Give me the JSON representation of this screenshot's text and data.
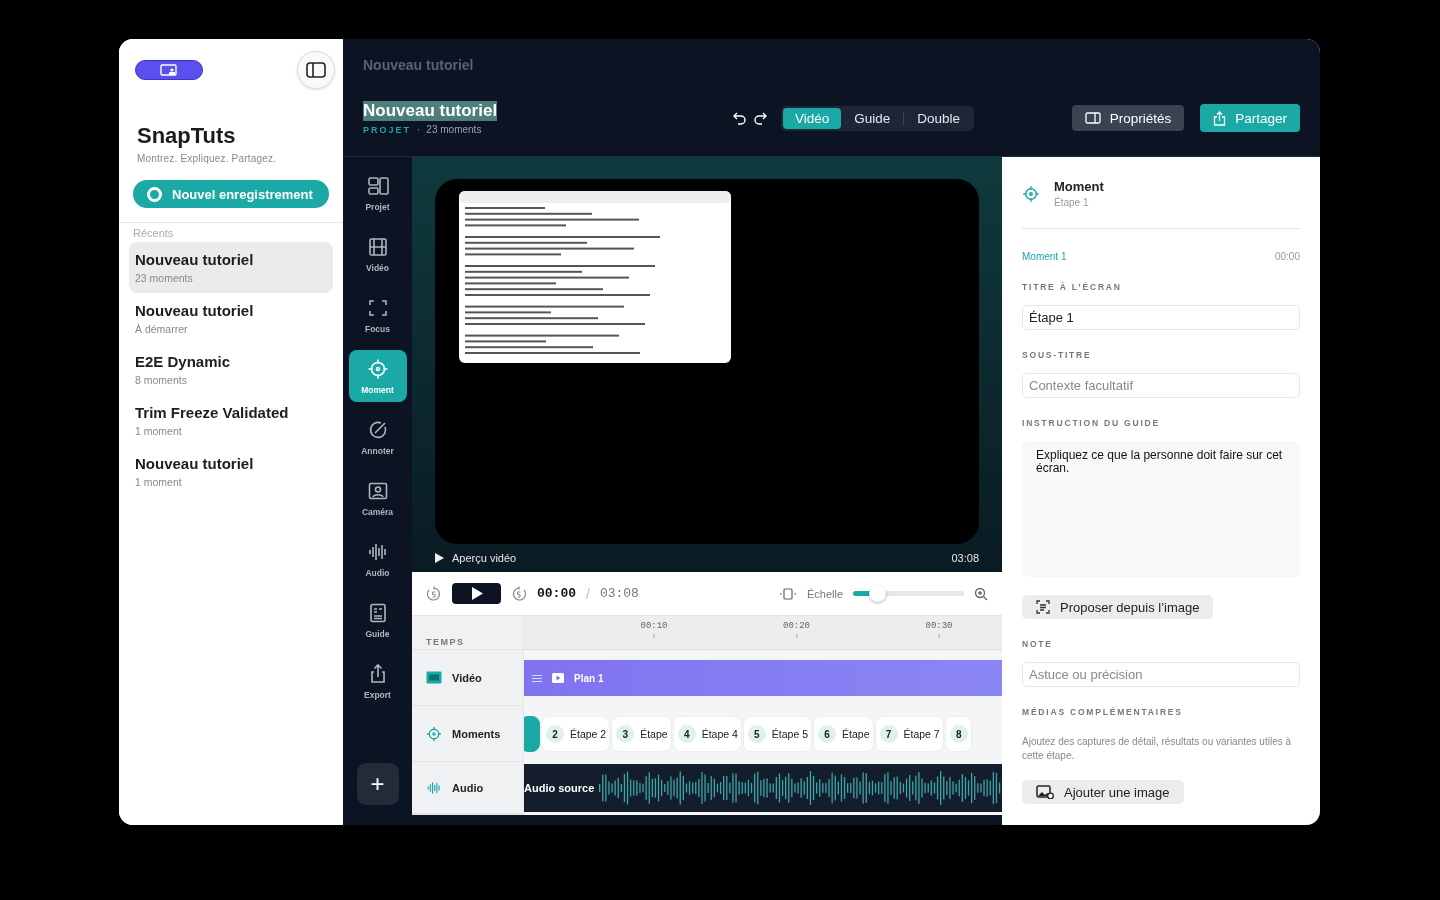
{
  "sidebar": {
    "title": "SnapTuts",
    "tagline": "Montrez. Expliquez. Partagez.",
    "record_button": "Nouvel enregistrement",
    "recents_label": "Récents",
    "recents": [
      {
        "title": "Nouveau tutoriel",
        "subtitle": "23 moments",
        "selected": true
      },
      {
        "title": "Nouveau tutoriel",
        "subtitle": "À démarrer",
        "selected": false
      },
      {
        "title": "E2E Dynamic",
        "subtitle": "8 moments",
        "selected": false
      },
      {
        "title": "Trim Freeze Validated",
        "subtitle": "1 moment",
        "selected": false
      },
      {
        "title": "Nouveau tutoriel",
        "subtitle": "1 moment",
        "selected": false
      }
    ]
  },
  "header": {
    "window_title": "Nouveau tutoriel",
    "project_title": "Nouveau tutoriel",
    "project_label": "PROJET",
    "separator": "·",
    "moments_count": "23 moments",
    "view_tabs": [
      {
        "label": "Vidéo",
        "selected": true
      },
      {
        "label": "Guide",
        "selected": false
      },
      {
        "label": "Double",
        "selected": false
      }
    ],
    "properties_button": "Propriétés",
    "share_button": "Partager"
  },
  "rail": {
    "items": [
      {
        "label": "Projet",
        "kind": "layout",
        "selected": false
      },
      {
        "label": "Vidéo",
        "kind": "film",
        "selected": false
      },
      {
        "label": "Focus",
        "kind": "focus",
        "selected": false
      },
      {
        "label": "Moment",
        "kind": "target",
        "selected": true
      },
      {
        "label": "Annoter",
        "kind": "annotate",
        "selected": false
      },
      {
        "label": "Caméra",
        "kind": "camera",
        "selected": false
      },
      {
        "label": "Audio",
        "kind": "audio",
        "selected": false
      },
      {
        "label": "Guide",
        "kind": "guide",
        "selected": false
      },
      {
        "label": "Export",
        "kind": "export",
        "selected": false
      }
    ],
    "add_button": "+"
  },
  "preview": {
    "caption": "Aperçu vidéo",
    "duration": "03:08"
  },
  "player": {
    "current_time": "00:00",
    "separator": "/",
    "total_time": "03:08",
    "scale_label": "Échelle",
    "level": 0.22
  },
  "timeline": {
    "header": "TEMPS",
    "ticks": [
      "00:10",
      "00:20",
      "00:30"
    ],
    "tracks": [
      {
        "kind": "video",
        "label": "Vidéo"
      },
      {
        "kind": "moments",
        "label": "Moments"
      },
      {
        "kind": "audio",
        "label": "Audio"
      }
    ],
    "clip": "Plan 1",
    "audio_label": "Audio source",
    "moments": [
      {
        "selected": true
      },
      {
        "number": "2",
        "label": "Étape 2",
        "selected": false
      },
      {
        "number": "3",
        "label": "Étape",
        "selected": false
      },
      {
        "number": "4",
        "label": "Étape 4",
        "selected": false
      },
      {
        "number": "5",
        "label": "Étape 5",
        "selected": false
      },
      {
        "number": "6",
        "label": "Étape",
        "selected": false
      },
      {
        "number": "7",
        "label": "Étape 7",
        "selected": false
      },
      {
        "number": "8",
        "selected": false
      }
    ]
  },
  "inspector": {
    "title": "Moment",
    "subtitle": "Étape 1",
    "moment_label": "Moment 1",
    "moment_time": "00:00",
    "items": [
      {
        "kind": "label",
        "text": "TITRE À L’ÉCRAN"
      },
      {
        "kind": "input",
        "value": "Étape 1"
      },
      {
        "kind": "label",
        "text": "SOUS-TITRE"
      },
      {
        "kind": "input",
        "placeholder": "Contexte facultatif"
      },
      {
        "kind": "label",
        "text": "INSTRUCTION DU GUIDE"
      },
      {
        "kind": "textarea",
        "value": "Expliquez ce que la personne doit faire sur cet écran."
      },
      {
        "kind": "button",
        "text": "Proposer depuis l’image"
      },
      {
        "kind": "label",
        "text": "NOTE"
      },
      {
        "kind": "input",
        "placeholder": "Astuce ou précision"
      },
      {
        "kind": "label",
        "text": "MÉDIAS COMPLÉMENTAIRES"
      },
      {
        "kind": "hint",
        "text": "Ajoutez des captures de détail, résultats ou variantes utiles à cette étape."
      },
      {
        "kind": "button",
        "text": "Ajouter une image"
      }
    ]
  }
}
